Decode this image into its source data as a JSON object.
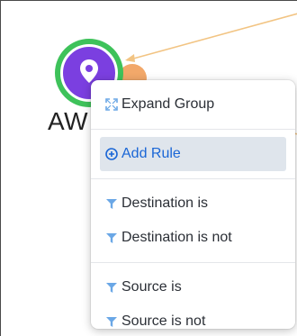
{
  "graph": {
    "node_label": "AW",
    "colors": {
      "node_ring": "#3ec25a",
      "node_fill": "#7b3fe0",
      "badge": "#f2a86a",
      "edge": "#f2c483"
    },
    "node_icon": "map-pin-icon"
  },
  "context_menu": {
    "items": [
      {
        "label": "Expand Group",
        "icon": "expand-icon"
      },
      {
        "label": "Add Rule",
        "icon": "plus-circle-icon",
        "highlighted": true
      },
      {
        "label": "Destination is",
        "icon": "filter-icon"
      },
      {
        "label": "Destination is not",
        "icon": "filter-icon"
      },
      {
        "label": "Source is",
        "icon": "filter-icon"
      },
      {
        "label": "Source is not",
        "icon": "filter-icon"
      }
    ],
    "colors": {
      "accent": "#1a66d6",
      "icon": "#6aa7e6",
      "highlight_bg": "#dfe5ec"
    }
  }
}
